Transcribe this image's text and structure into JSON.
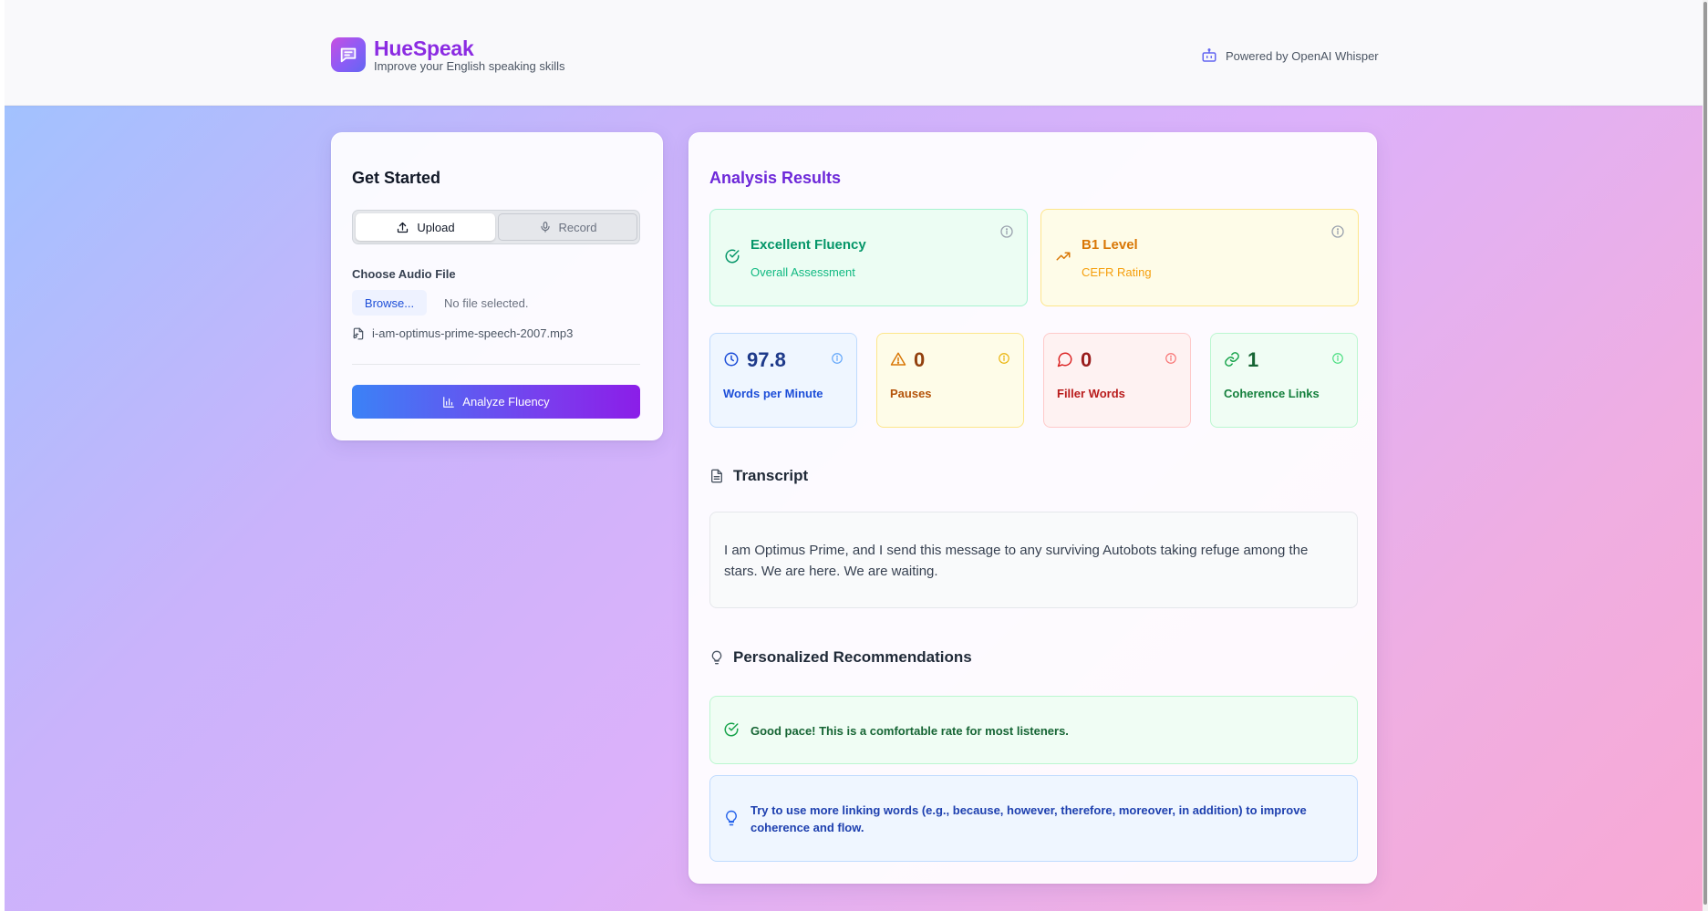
{
  "brand": {
    "name": "HueSpeak",
    "tagline": "Improve your English speaking skills",
    "powered_by": "Powered by OpenAI Whisper",
    "icon": "chat-bubble-icon"
  },
  "get_started": {
    "title": "Get Started",
    "tabs": {
      "upload": "Upload",
      "record": "Record",
      "active": "upload"
    },
    "choose_label": "Choose Audio File",
    "browse_button": "Browse...",
    "no_file": "No file selected.",
    "file_name": "i-am-optimus-prime-speech-2007.mp3",
    "analyze_button": "Analyze Fluency"
  },
  "results": {
    "title": "Analysis Results",
    "assessment": {
      "title": "Excellent Fluency",
      "subtitle": "Overall Assessment",
      "color": "#059669"
    },
    "cefr": {
      "title": "B1 Level",
      "subtitle": "CEFR Rating",
      "color": "#d97706"
    },
    "metrics": [
      {
        "value": "97.8",
        "label": "Words per Minute",
        "icon": "clock-icon",
        "color": "#1e3a8a"
      },
      {
        "value": "0",
        "label": "Pauses",
        "icon": "warning-triangle-icon",
        "color": "#92400e"
      },
      {
        "value": "0",
        "label": "Filler Words",
        "icon": "speech-bubble-icon",
        "color": "#991b1b"
      },
      {
        "value": "1",
        "label": "Coherence Links",
        "icon": "link-icon",
        "color": "#166534"
      }
    ],
    "transcript_title": "Transcript",
    "transcript": "I am Optimus Prime, and I send this message to any surviving Autobots taking refuge among the stars. We are here. We are waiting.",
    "recommendations_title": "Personalized Recommendations",
    "recommendations": [
      {
        "text": "Good pace! This is a comfortable rate for most listeners.",
        "icon": "check-circle-icon",
        "color": "#166534"
      },
      {
        "text": "Try to use more linking words (e.g., because, however, therefore, moreover, in addition) to improve coherence and flow.",
        "icon": "lightbulb-icon",
        "color": "#1e40af"
      }
    ]
  }
}
